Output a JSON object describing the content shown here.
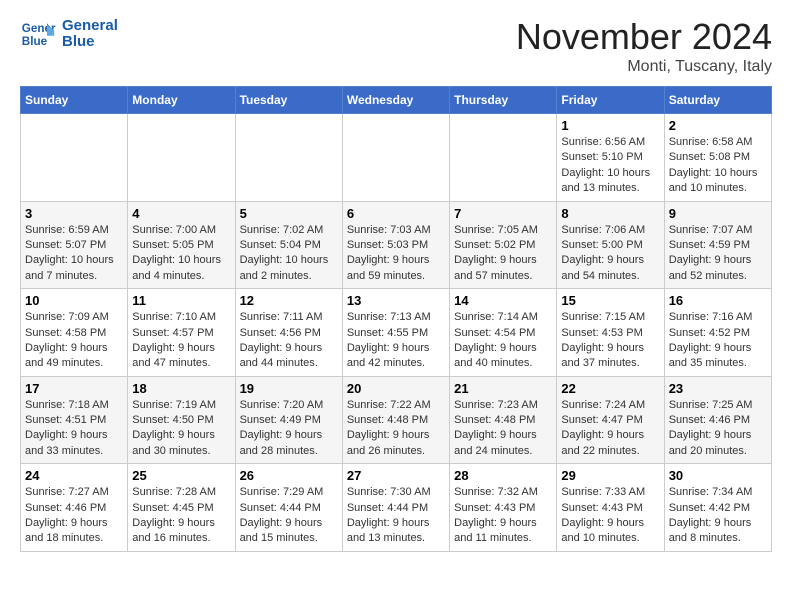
{
  "header": {
    "logo_general": "General",
    "logo_blue": "Blue",
    "month_title": "November 2024",
    "location": "Monti, Tuscany, Italy"
  },
  "calendar": {
    "days_of_week": [
      "Sunday",
      "Monday",
      "Tuesday",
      "Wednesday",
      "Thursday",
      "Friday",
      "Saturday"
    ],
    "weeks": [
      [
        {
          "day": "",
          "info": ""
        },
        {
          "day": "",
          "info": ""
        },
        {
          "day": "",
          "info": ""
        },
        {
          "day": "",
          "info": ""
        },
        {
          "day": "",
          "info": ""
        },
        {
          "day": "1",
          "info": "Sunrise: 6:56 AM\nSunset: 5:10 PM\nDaylight: 10 hours and 13 minutes."
        },
        {
          "day": "2",
          "info": "Sunrise: 6:58 AM\nSunset: 5:08 PM\nDaylight: 10 hours and 10 minutes."
        }
      ],
      [
        {
          "day": "3",
          "info": "Sunrise: 6:59 AM\nSunset: 5:07 PM\nDaylight: 10 hours and 7 minutes."
        },
        {
          "day": "4",
          "info": "Sunrise: 7:00 AM\nSunset: 5:05 PM\nDaylight: 10 hours and 4 minutes."
        },
        {
          "day": "5",
          "info": "Sunrise: 7:02 AM\nSunset: 5:04 PM\nDaylight: 10 hours and 2 minutes."
        },
        {
          "day": "6",
          "info": "Sunrise: 7:03 AM\nSunset: 5:03 PM\nDaylight: 9 hours and 59 minutes."
        },
        {
          "day": "7",
          "info": "Sunrise: 7:05 AM\nSunset: 5:02 PM\nDaylight: 9 hours and 57 minutes."
        },
        {
          "day": "8",
          "info": "Sunrise: 7:06 AM\nSunset: 5:00 PM\nDaylight: 9 hours and 54 minutes."
        },
        {
          "day": "9",
          "info": "Sunrise: 7:07 AM\nSunset: 4:59 PM\nDaylight: 9 hours and 52 minutes."
        }
      ],
      [
        {
          "day": "10",
          "info": "Sunrise: 7:09 AM\nSunset: 4:58 PM\nDaylight: 9 hours and 49 minutes."
        },
        {
          "day": "11",
          "info": "Sunrise: 7:10 AM\nSunset: 4:57 PM\nDaylight: 9 hours and 47 minutes."
        },
        {
          "day": "12",
          "info": "Sunrise: 7:11 AM\nSunset: 4:56 PM\nDaylight: 9 hours and 44 minutes."
        },
        {
          "day": "13",
          "info": "Sunrise: 7:13 AM\nSunset: 4:55 PM\nDaylight: 9 hours and 42 minutes."
        },
        {
          "day": "14",
          "info": "Sunrise: 7:14 AM\nSunset: 4:54 PM\nDaylight: 9 hours and 40 minutes."
        },
        {
          "day": "15",
          "info": "Sunrise: 7:15 AM\nSunset: 4:53 PM\nDaylight: 9 hours and 37 minutes."
        },
        {
          "day": "16",
          "info": "Sunrise: 7:16 AM\nSunset: 4:52 PM\nDaylight: 9 hours and 35 minutes."
        }
      ],
      [
        {
          "day": "17",
          "info": "Sunrise: 7:18 AM\nSunset: 4:51 PM\nDaylight: 9 hours and 33 minutes."
        },
        {
          "day": "18",
          "info": "Sunrise: 7:19 AM\nSunset: 4:50 PM\nDaylight: 9 hours and 30 minutes."
        },
        {
          "day": "19",
          "info": "Sunrise: 7:20 AM\nSunset: 4:49 PM\nDaylight: 9 hours and 28 minutes."
        },
        {
          "day": "20",
          "info": "Sunrise: 7:22 AM\nSunset: 4:48 PM\nDaylight: 9 hours and 26 minutes."
        },
        {
          "day": "21",
          "info": "Sunrise: 7:23 AM\nSunset: 4:48 PM\nDaylight: 9 hours and 24 minutes."
        },
        {
          "day": "22",
          "info": "Sunrise: 7:24 AM\nSunset: 4:47 PM\nDaylight: 9 hours and 22 minutes."
        },
        {
          "day": "23",
          "info": "Sunrise: 7:25 AM\nSunset: 4:46 PM\nDaylight: 9 hours and 20 minutes."
        }
      ],
      [
        {
          "day": "24",
          "info": "Sunrise: 7:27 AM\nSunset: 4:46 PM\nDaylight: 9 hours and 18 minutes."
        },
        {
          "day": "25",
          "info": "Sunrise: 7:28 AM\nSunset: 4:45 PM\nDaylight: 9 hours and 16 minutes."
        },
        {
          "day": "26",
          "info": "Sunrise: 7:29 AM\nSunset: 4:44 PM\nDaylight: 9 hours and 15 minutes."
        },
        {
          "day": "27",
          "info": "Sunrise: 7:30 AM\nSunset: 4:44 PM\nDaylight: 9 hours and 13 minutes."
        },
        {
          "day": "28",
          "info": "Sunrise: 7:32 AM\nSunset: 4:43 PM\nDaylight: 9 hours and 11 minutes."
        },
        {
          "day": "29",
          "info": "Sunrise: 7:33 AM\nSunset: 4:43 PM\nDaylight: 9 hours and 10 minutes."
        },
        {
          "day": "30",
          "info": "Sunrise: 7:34 AM\nSunset: 4:42 PM\nDaylight: 9 hours and 8 minutes."
        }
      ]
    ]
  }
}
